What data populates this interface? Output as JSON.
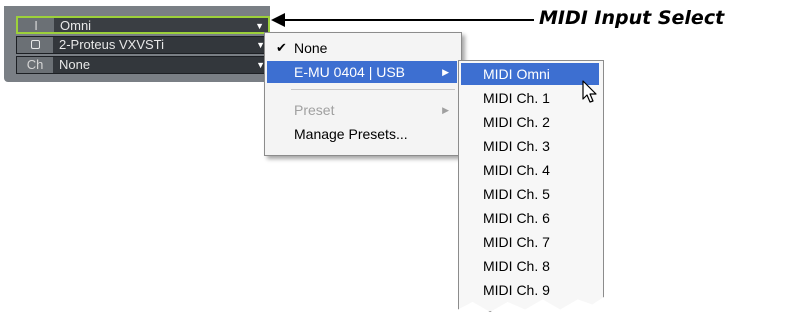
{
  "track": {
    "input_tag": "I",
    "input_value": "Omni",
    "output_value": "2-Proteus VXVSTi",
    "channel_tag": "Ch",
    "channel_value": "None"
  },
  "callout": {
    "label": "MIDI Input Select"
  },
  "menu": {
    "items": [
      {
        "label": "None",
        "checked": true
      },
      {
        "label": "E-MU 0404 | USB",
        "submenu": true
      },
      {
        "label": "Preset",
        "disabled": true,
        "submenu": true
      },
      {
        "label": "Manage Presets..."
      }
    ]
  },
  "submenu": {
    "items": [
      "MIDI Omni",
      "MIDI Ch. 1",
      "MIDI Ch. 2",
      "MIDI Ch. 3",
      "MIDI Ch. 4",
      "MIDI Ch. 5",
      "MIDI Ch. 6",
      "MIDI Ch. 7",
      "MIDI Ch. 8",
      "MIDI Ch. 9"
    ],
    "selected_index": 0
  },
  "icons": {
    "checkmark": "checkmark-icon",
    "submenu_arrow": "chevron-right-icon",
    "dropdown_arrow": "chevron-down-icon",
    "cursor": "mouse-pointer-icon"
  },
  "colors": {
    "selection": "#3d6fd1",
    "focus_border": "#9dd13a",
    "track_bg": "#33373c"
  }
}
